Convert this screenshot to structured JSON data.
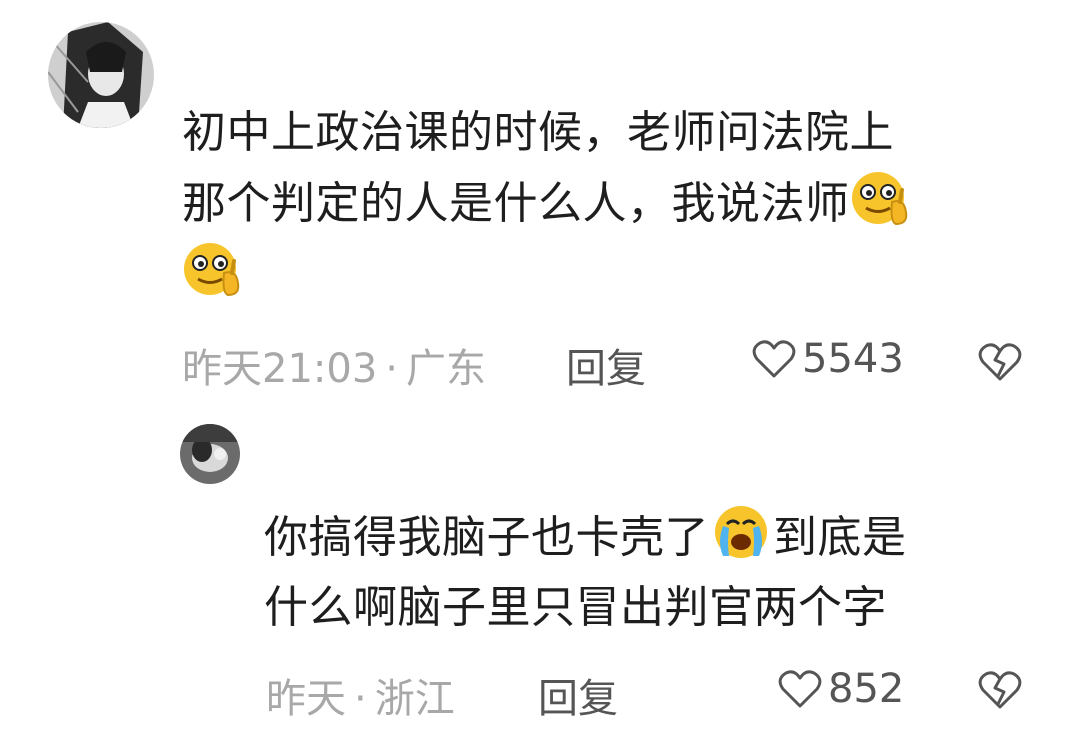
{
  "comments": [
    {
      "author_avatar": "anime-girl-avatar",
      "lines": [
        "初中上政治课的时候，老师问法院上",
        "那个判定的人是什么人，我说法师"
      ],
      "emoji": "thinking-face-emoji",
      "time": "昨天21:03",
      "separator": "·",
      "location": "广东",
      "reply_label": "回复",
      "likes": "5543",
      "dislike_icon": "broken-heart-icon"
    },
    {
      "author_avatar": "photo-avatar",
      "lines": [
        "你搞得我脑子也卡壳了",
        "到底是",
        "什么啊脑子里只冒出判官两个字"
      ],
      "emoji": "crying-face-emoji",
      "time": "昨天",
      "separator": "·",
      "location": "浙江",
      "reply_label": "回复",
      "likes": "852",
      "dislike_icon": "broken-heart-icon"
    }
  ],
  "colors": {
    "text": "#1e1e1e",
    "meta": "#a8a8a8",
    "action": "#555555",
    "emoji_yellow": "#f7c52b"
  }
}
